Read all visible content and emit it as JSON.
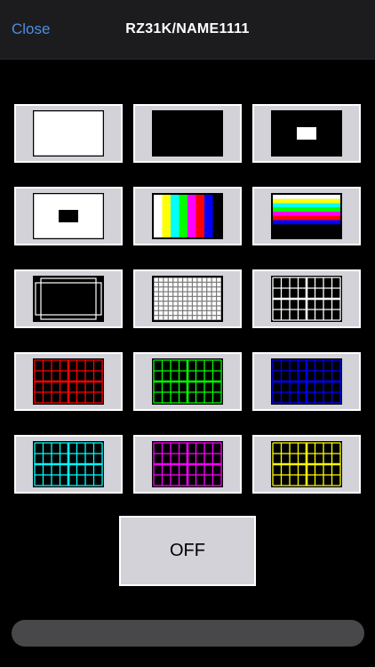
{
  "header": {
    "close_label": "Close",
    "title": "RZ31K/NAME1111"
  },
  "patterns": [
    {
      "name": "white-raster-pattern-button",
      "kind": "raster",
      "fill": "#ffffff"
    },
    {
      "name": "black-raster-pattern-button",
      "kind": "raster",
      "fill": "#000000"
    },
    {
      "name": "window-white-pattern-button",
      "kind": "window",
      "fill": "#000000",
      "inner": "#ffffff"
    },
    {
      "name": "window-black-pattern-button",
      "kind": "window",
      "fill": "#ffffff",
      "inner": "#000000"
    },
    {
      "name": "color-bar-vertical-pattern-button",
      "kind": "vbars",
      "colors": [
        "#ffffff",
        "#ffff00",
        "#00ffff",
        "#00ff00",
        "#ff00ff",
        "#ff0000",
        "#0000ff",
        "#000000"
      ]
    },
    {
      "name": "color-bar-horizontal-pattern-button",
      "kind": "hbars",
      "colors": [
        "#ffffff",
        "#ffff00",
        "#00ffff",
        "#00ff00",
        "#ff00ff",
        "#ff0000",
        "#0000ff",
        "#000000"
      ]
    },
    {
      "name": "aspect-frame-pattern-button",
      "kind": "frames"
    },
    {
      "name": "crosshatch-fine-pattern-button",
      "kind": "finehatch"
    },
    {
      "name": "crosshatch-white-pattern-button",
      "kind": "hatch",
      "color": "#ffffff"
    },
    {
      "name": "crosshatch-red-pattern-button",
      "kind": "hatch",
      "color": "#ff0000"
    },
    {
      "name": "crosshatch-green-pattern-button",
      "kind": "hatch",
      "color": "#00ff00"
    },
    {
      "name": "crosshatch-blue-pattern-button",
      "kind": "hatch",
      "color": "#0000ff"
    },
    {
      "name": "crosshatch-cyan-pattern-button",
      "kind": "hatch",
      "color": "#00ffff"
    },
    {
      "name": "crosshatch-magenta-pattern-button",
      "kind": "hatch",
      "color": "#ff00ff"
    },
    {
      "name": "crosshatch-yellow-pattern-button",
      "kind": "hatch",
      "color": "#ffff00"
    }
  ],
  "off_label": "OFF"
}
